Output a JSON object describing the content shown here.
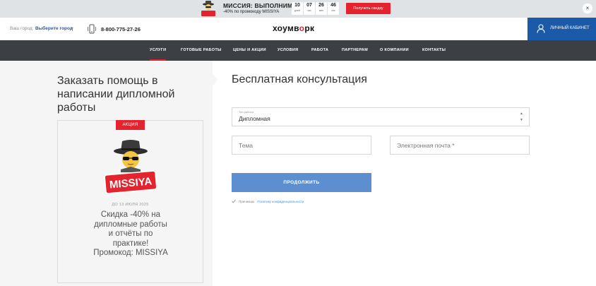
{
  "promo_bar": {
    "mascot_text": "MISSIYA",
    "title": "МИССИЯ: ВЫПОЛНИМА",
    "subtitle": "-40% по промокоду MISSIYA",
    "timer": [
      {
        "value": "10",
        "unit": "дней"
      },
      {
        "value": "07",
        "unit": "час"
      },
      {
        "value": "26",
        "unit": "мин"
      },
      {
        "value": "46",
        "unit": "сек"
      }
    ],
    "button": "Получить скидку",
    "close": "×"
  },
  "header": {
    "city_label": "Ваш город:",
    "city_value": "Выберите город",
    "phone": "8-800-775-27-26",
    "logo_before": "хоумв",
    "logo_o": "о",
    "logo_after": "рк",
    "cabinet": "ЛИЧНЫЙ КАБИНЕТ"
  },
  "nav": {
    "items": [
      {
        "label": "УСЛУГИ",
        "active": true
      },
      {
        "label": "ГОТОВЫЕ РАБОТЫ"
      },
      {
        "label": "ЦЕНЫ И АКЦИИ"
      },
      {
        "label": "УСЛОВИЯ"
      },
      {
        "label": "РАБОТА"
      },
      {
        "label": "ПАРТНЕРАМ"
      },
      {
        "label": "О КОМПАНИИ"
      },
      {
        "label": "КОНТАКТЫ"
      }
    ]
  },
  "left": {
    "title": "Заказать помощь в написании дипломной работы",
    "badge": "АКЦИЯ",
    "mascot_text": "MISSIYA",
    "date": "ДО 13 ИЮЛЯ 2025",
    "text": "Скидка -40% на дипломные работы и отчёты по практике! Промокод: MISSIYA"
  },
  "form": {
    "title": "Бесплатная консультация",
    "work_type_label": "Тип работы",
    "work_type_value": "Дипломная",
    "topic_placeholder": "Тема",
    "email_placeholder": "Электронная почта *",
    "submit": "ПРОДОЛЖИТЬ",
    "agree_text": "Принимаю",
    "agree_link": "Политику конфиденциальности"
  },
  "colors": {
    "accent": "#e4232e",
    "cabinet": "#1a5aa8",
    "nav_bg": "#3c3f44",
    "submit": "#5d8fd0"
  }
}
